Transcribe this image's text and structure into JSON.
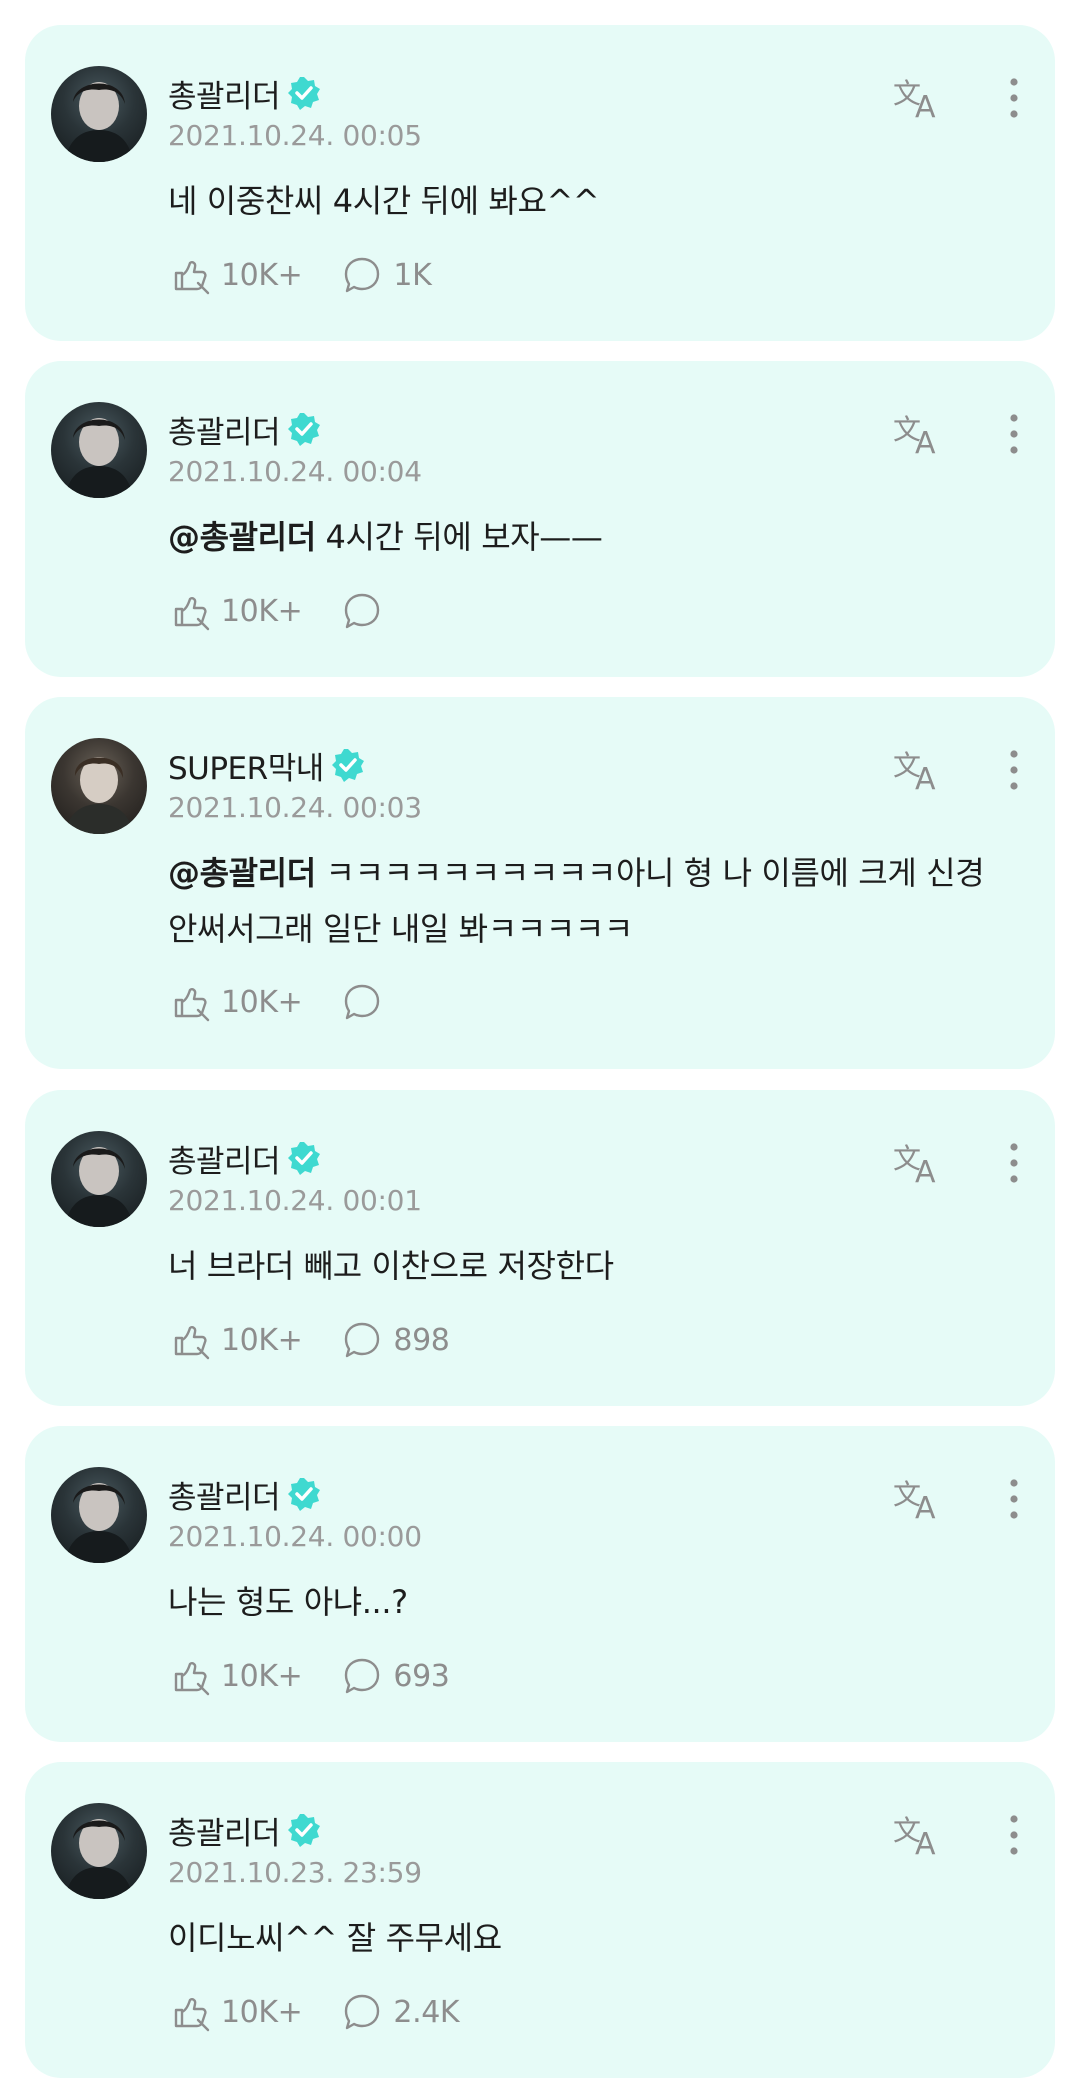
{
  "colors": {
    "card_bg": "#e6fbf7",
    "verified": "#3fd9d0",
    "muted": "#9a9a9a",
    "text": "#1d1d1d"
  },
  "posts": [
    {
      "author": "총괄리더",
      "verified": true,
      "timestamp": "2021.10.24. 00:05",
      "mention": "",
      "text": "네 이중찬씨 4시간 뒤에 봐요^^",
      "like_count": "10K+",
      "comment_count": "1K"
    },
    {
      "author": "총괄리더",
      "verified": true,
      "timestamp": "2021.10.24. 00:04",
      "mention": "@총괄리더",
      "text": " 4시간 뒤에 보자——",
      "like_count": "10K+",
      "comment_count": ""
    },
    {
      "author": "SUPER막내",
      "verified": true,
      "timestamp": "2021.10.24. 00:03",
      "mention": "@총괄리더",
      "text": " ㅋㅋㅋㅋㅋㅋㅋㅋㅋㅋ아니 형 나 이름에 크게 신경안써서그래 일단 내일 봐ㅋㅋㅋㅋㅋ",
      "like_count": "10K+",
      "comment_count": ""
    },
    {
      "author": "총괄리더",
      "verified": true,
      "timestamp": "2021.10.24. 00:01",
      "mention": "",
      "text": "너 브라더 빼고 이찬으로 저장한다",
      "like_count": "10K+",
      "comment_count": "898"
    },
    {
      "author": "총괄리더",
      "verified": true,
      "timestamp": "2021.10.24. 00:00",
      "mention": "",
      "text": "나는 형도 아냐...?",
      "like_count": "10K+",
      "comment_count": "693"
    },
    {
      "author": "총괄리더",
      "verified": true,
      "timestamp": "2021.10.23. 23:59",
      "mention": "",
      "text": "이디노씨^^ 잘 주무세요",
      "like_count": "10K+",
      "comment_count": "2.4K"
    }
  ],
  "icons": {
    "verified": "verified-badge-icon",
    "translate": "translate-icon",
    "more": "more-vertical-icon",
    "like": "like-icon",
    "comment": "comment-bubble-icon"
  }
}
